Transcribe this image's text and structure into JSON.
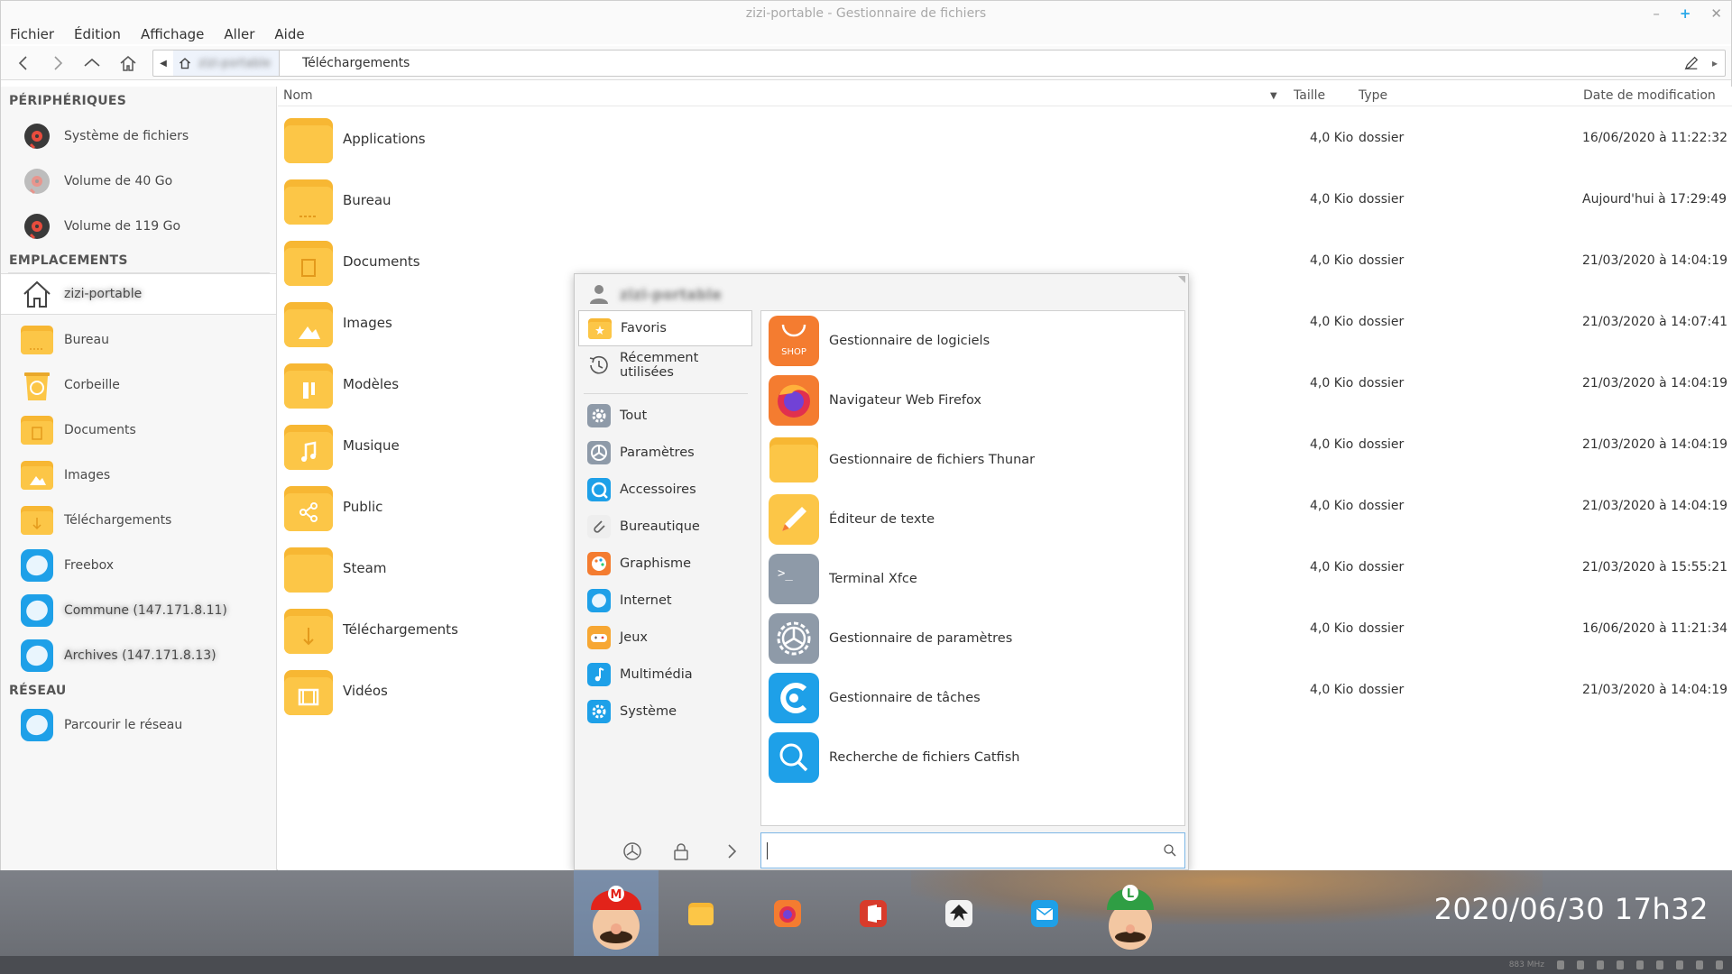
{
  "window": {
    "title": "zizi-portable - Gestionnaire de fichiers"
  },
  "menubar": [
    "Fichier",
    "Édition",
    "Affichage",
    "Aller",
    "Aide"
  ],
  "path": {
    "home_label": "zizi-portable",
    "current": "Téléchargements"
  },
  "sidebar": {
    "devices_title": "PÉRIPHÉRIQUES",
    "devices": [
      "Système de fichiers",
      "Volume de 40 Go",
      "Volume de 119 Go"
    ],
    "places_title": "EMPLACEMENTS",
    "places": [
      {
        "label": "zizi-portable",
        "icon": "home-icon"
      },
      {
        "label": "Bureau",
        "icon": "folder-desktop-icon"
      },
      {
        "label": "Corbeille",
        "icon": "trash-icon"
      },
      {
        "label": "Documents",
        "icon": "folder-documents-icon"
      },
      {
        "label": "Images",
        "icon": "folder-images-icon"
      },
      {
        "label": "Téléchargements",
        "icon": "folder-downloads-icon"
      },
      {
        "label": "Freebox",
        "icon": "network-share-icon"
      },
      {
        "label": "Commune (147.171.8.11)",
        "icon": "network-share-icon"
      },
      {
        "label": "Archives (147.171.8.13)",
        "icon": "network-share-icon"
      }
    ],
    "network_title": "RÉSEAU",
    "network": [
      "Parcourir le réseau"
    ]
  },
  "columns": {
    "name": "Nom",
    "size": "Taille",
    "type": "Type",
    "date": "Date de modification"
  },
  "files": [
    {
      "name": "Applications",
      "size": "4,0 Kio",
      "type": "dossier",
      "date": "16/06/2020 à 11:22:32"
    },
    {
      "name": "Bureau",
      "size": "4,0 Kio",
      "type": "dossier",
      "date": "Aujourd'hui à 17:29:49"
    },
    {
      "name": "Documents",
      "size": "4,0 Kio",
      "type": "dossier",
      "date": "21/03/2020 à 14:04:19"
    },
    {
      "name": "Images",
      "size": "4,0 Kio",
      "type": "dossier",
      "date": "21/03/2020 à 14:07:41"
    },
    {
      "name": "Modèles",
      "size": "4,0 Kio",
      "type": "dossier",
      "date": "21/03/2020 à 14:04:19"
    },
    {
      "name": "Musique",
      "size": "4,0 Kio",
      "type": "dossier",
      "date": "21/03/2020 à 14:04:19"
    },
    {
      "name": "Public",
      "size": "4,0 Kio",
      "type": "dossier",
      "date": "21/03/2020 à 14:04:19"
    },
    {
      "name": "Steam",
      "size": "4,0 Kio",
      "type": "dossier",
      "date": "21/03/2020 à 15:55:21"
    },
    {
      "name": "Téléchargements",
      "size": "4,0 Kio",
      "type": "dossier",
      "date": "16/06/2020 à 11:21:34"
    },
    {
      "name": "Vidéos",
      "size": "4,0 Kio",
      "type": "dossier",
      "date": "21/03/2020 à 14:04:19"
    }
  ],
  "app_menu": {
    "user": "zizi-portable",
    "categories": [
      {
        "label": "Favoris",
        "color": "#f7b733"
      },
      {
        "label": "Récemment utilisées",
        "color": "#666666"
      },
      {
        "label": "Tout",
        "color": "#8e9aa8"
      },
      {
        "label": "Paramètres",
        "color": "#8e9aa8"
      },
      {
        "label": "Accessoires",
        "color": "#1ea0e8"
      },
      {
        "label": "Bureautique",
        "color": "#8e9aa8"
      },
      {
        "label": "Graphisme",
        "color": "#f47c30"
      },
      {
        "label": "Internet",
        "color": "#1ea0e8"
      },
      {
        "label": "Jeux",
        "color": "#f7a733"
      },
      {
        "label": "Multimédia",
        "color": "#1ea0e8"
      },
      {
        "label": "Système",
        "color": "#1ea0e8"
      }
    ],
    "apps": [
      {
        "label": "Gestionnaire de logiciels",
        "icon": "shop-icon",
        "badge": "SHOP"
      },
      {
        "label": "Navigateur Web Firefox",
        "icon": "firefox-icon"
      },
      {
        "label": "Gestionnaire de fichiers Thunar",
        "icon": "folder-icon"
      },
      {
        "label": "Éditeur de texte",
        "icon": "text-editor-icon"
      },
      {
        "label": "Terminal Xfce",
        "icon": "terminal-icon",
        "prompt": ">_"
      },
      {
        "label": "Gestionnaire de paramètres",
        "icon": "settings-icon"
      },
      {
        "label": "Gestionnaire de tâches",
        "icon": "task-manager-icon"
      },
      {
        "label": "Recherche de fichiers Catfish",
        "icon": "search-icon"
      }
    ],
    "search": {
      "placeholder": ""
    }
  },
  "dock": {
    "clock": "2020/06/30  17h32",
    "cpu_freq": "883 MHz"
  },
  "mario_letter": "M",
  "luigi_letter": "L"
}
